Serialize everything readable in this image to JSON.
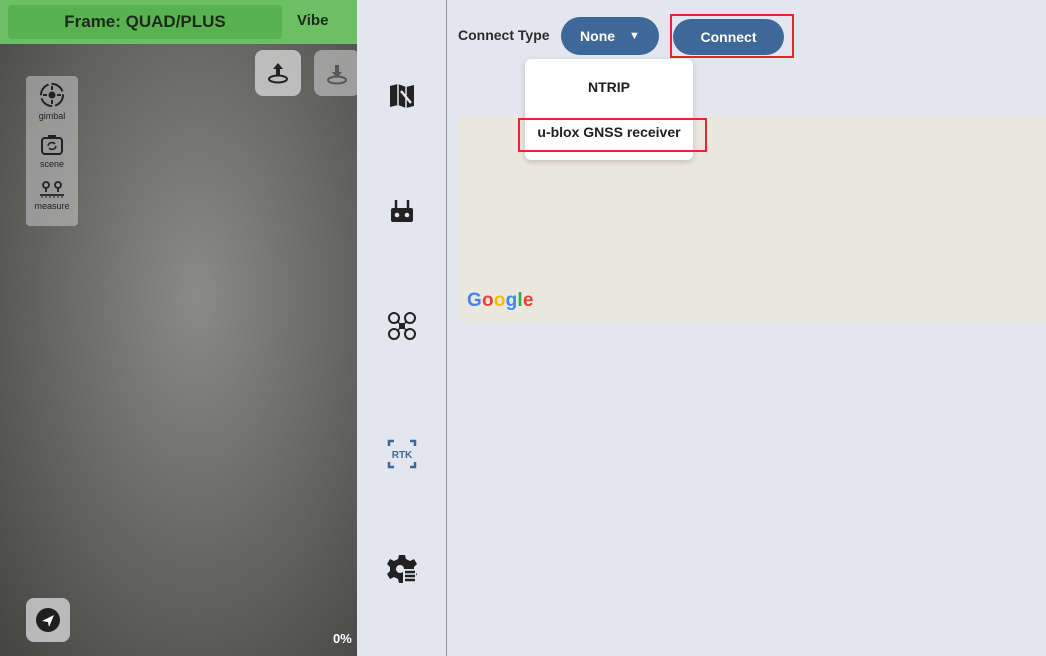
{
  "camera": {
    "frame_label": "Frame: QUAD/PLUS",
    "vibe_label": "Vibe",
    "tools": [
      {
        "label": "gimbal",
        "icon": "gimbal-icon"
      },
      {
        "label": "scene",
        "icon": "scene-icon"
      },
      {
        "label": "measure",
        "icon": "measure-icon"
      }
    ],
    "percent": "0%"
  },
  "nav": {
    "rtk_label": "RTK"
  },
  "rtk": {
    "connect_type_label": "Connect Type",
    "selected_type": "None",
    "dropdown_arrow": "▼",
    "connect_label": "Connect",
    "options": [
      "NTRIP",
      "u-blox GNSS receiver"
    ]
  },
  "map": {
    "logo": "Google"
  },
  "colors": {
    "accent": "#3e6898",
    "topbar": "#6cc063",
    "highlight": "#e5262d"
  }
}
